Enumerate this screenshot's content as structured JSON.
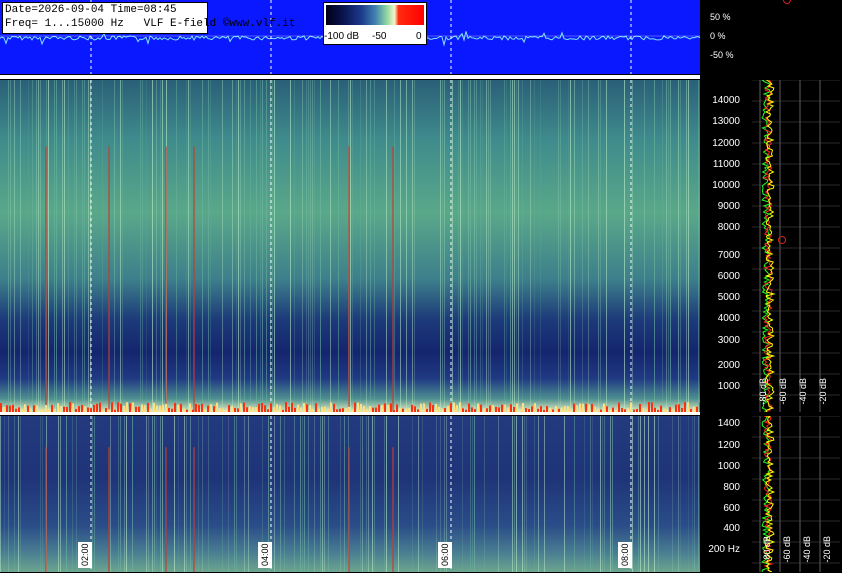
{
  "header": {
    "date_line": "Date=2026-09-04 Time=08:45",
    "freq_line": "Freq= 1...15000 Hz   VLF E-field ©www.vlf.it"
  },
  "colorbar": {
    "labels": [
      "-100 dB",
      "-50",
      "0"
    ]
  },
  "waveform_scale": [
    "50 %",
    "0 %",
    "-50 %"
  ],
  "time_axis": [
    "02:00",
    "04:00",
    "06:00",
    "08:00"
  ],
  "upper_freq_labels": [
    "14000",
    "13000",
    "12000",
    "11000",
    "10000",
    "9000",
    "8000",
    "7000",
    "6000",
    "5000",
    "4000",
    "3000",
    "2000",
    "1000"
  ],
  "lower_freq_labels": [
    "1400",
    "1200",
    "1000",
    "800",
    "600",
    "400",
    "200 Hz"
  ],
  "db_labels_upper": [
    "-80 dB",
    "-60 dB",
    "-40 dB",
    "-20 dB"
  ],
  "db_labels_lower": [
    "-80 dB",
    "-60 dB",
    "-40 dB",
    "-20 dB"
  ],
  "colors": {
    "waveform_bg": "#0a18ff",
    "grid_dashed": "#ffffff",
    "spectrum_yellow": "#ffff00",
    "spectrum_red": "#ff2020",
    "spectrum_green": "#20ff20"
  }
}
